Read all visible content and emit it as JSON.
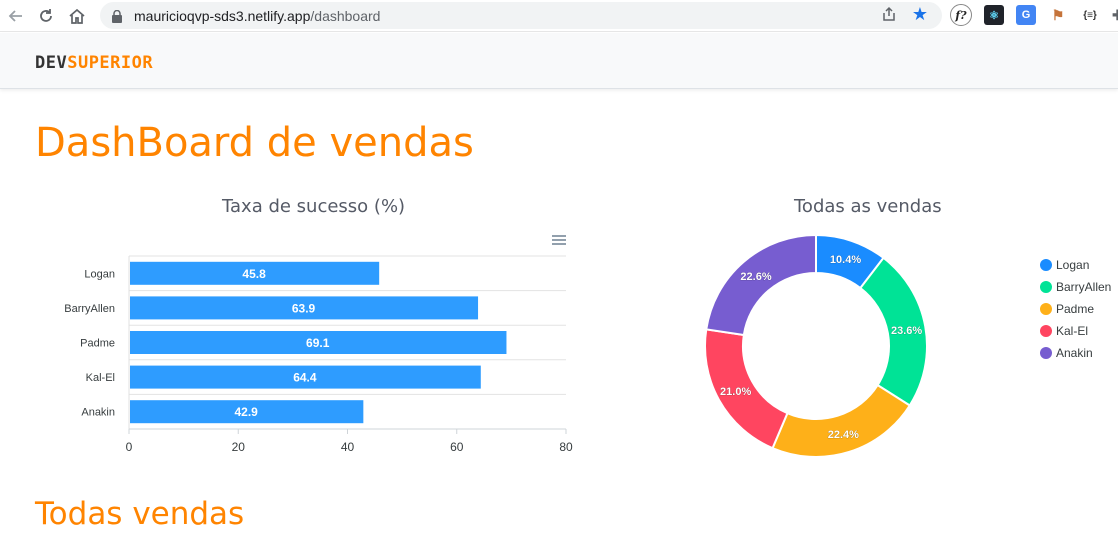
{
  "browser": {
    "url_host": "mauricioqvp-sds3.netlify.app",
    "url_path": "/dashboard"
  },
  "header": {
    "brand_dev": "DEV",
    "brand_superior": "SUPERIOR"
  },
  "page": {
    "title": "DashBoard de vendas",
    "section_title": "Todas vendas"
  },
  "colors": {
    "accent": "#ff8400",
    "bar": "#2e9cff"
  },
  "chart_data": [
    {
      "type": "bar",
      "orientation": "horizontal",
      "title": "Taxa de sucesso (%)",
      "categories": [
        "Logan",
        "BarryAllen",
        "Padme",
        "Kal-El",
        "Anakin"
      ],
      "values": [
        45.8,
        63.9,
        69.1,
        64.4,
        42.9
      ],
      "xlim": [
        0,
        80
      ],
      "ticks": [
        0,
        20,
        40,
        60,
        80
      ],
      "grid": true,
      "color": "#2e9cff"
    },
    {
      "type": "pie",
      "variant": "donut",
      "title": "Todas as vendas",
      "labels": [
        "Logan",
        "BarryAllen",
        "Padme",
        "Kal-El",
        "Anakin"
      ],
      "values": [
        10.4,
        23.6,
        22.4,
        21.0,
        22.6
      ],
      "value_labels": [
        "10.4%",
        "23.6%",
        "22.4%",
        "21.0%",
        "22.6%"
      ],
      "colors": [
        "#1a8cff",
        "#00e396",
        "#feb019",
        "#ff4560",
        "#775dd0"
      ],
      "legend": "right"
    }
  ]
}
